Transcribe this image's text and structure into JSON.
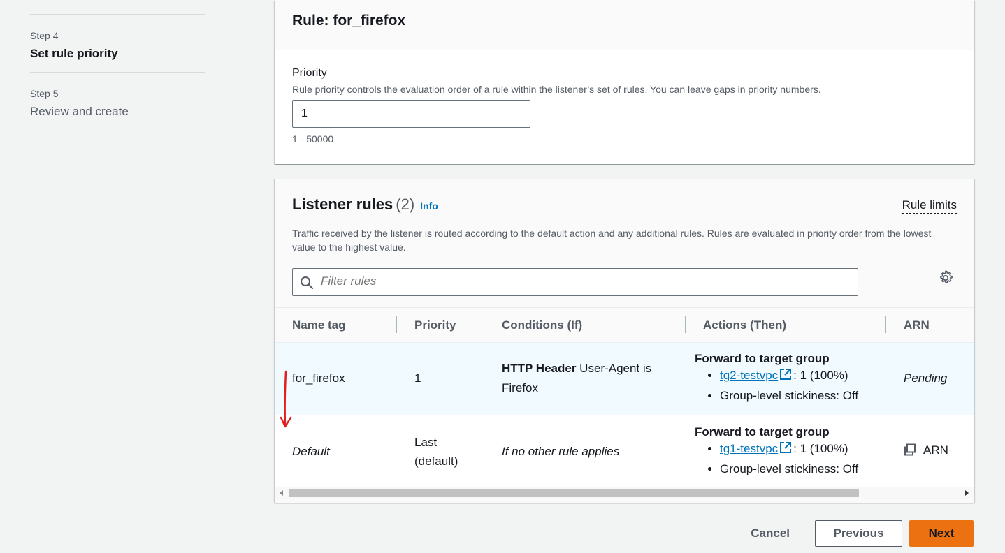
{
  "nav": {
    "step4_label": "Step 4",
    "step4_title": "Set rule priority",
    "step5_label": "Step 5",
    "step5_title": "Review and create"
  },
  "rule_card": {
    "title": "Rule: for_firefox",
    "priority_label": "Priority",
    "priority_desc": "Rule priority controls the evaluation order of a rule within the listener’s set of rules. You can leave gaps in priority numbers.",
    "priority_value": "1",
    "priority_hint": "1 - 50000"
  },
  "listener_rules": {
    "title": "Listener rules",
    "count": "(2)",
    "info": "Info",
    "rule_limits": "Rule limits",
    "description": "Traffic received by the listener is routed according to the default action and any additional rules. Rules are evaluated in priority order from the lowest value to the highest value.",
    "filter_placeholder": "Filter rules",
    "columns": [
      "Name tag",
      "Priority",
      "Conditions (If)",
      "Actions (Then)",
      "ARN"
    ],
    "rows": [
      {
        "name": "for_firefox",
        "priority": "1",
        "condition_bold": "HTTP Header",
        "condition_text": " User-Agent is Firefox",
        "action_title": "Forward to target group",
        "tg_link": "tg2-testvpc",
        "tg_weight": ": 1 (100%)",
        "stickiness": "Group-level stickiness: Off",
        "arn": "Pending"
      },
      {
        "name": "Default",
        "priority": "Last (default)",
        "condition": "If no other rule applies",
        "action_title": "Forward to target group",
        "tg_link": "tg1-testvpc",
        "tg_weight": ": 1 (100%)",
        "stickiness": "Group-level stickiness: Off",
        "arn": "ARN"
      }
    ]
  },
  "footer": {
    "cancel": "Cancel",
    "previous": "Previous",
    "next": "Next"
  },
  "colors": {
    "accent_link": "#0073bb",
    "primary_button": "#ec7211",
    "annotation": "#e02020"
  }
}
